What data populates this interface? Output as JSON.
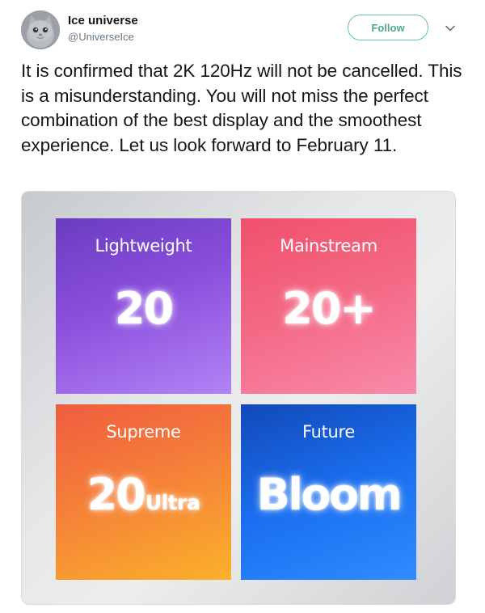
{
  "author": {
    "name": "Ice universe",
    "handle": "@UniverseIce",
    "avatar_icon": "cat-avatar-icon"
  },
  "actions": {
    "follow_label": "Follow",
    "more_icon": "chevron-down-icon"
  },
  "tweet": {
    "text": "It is confirmed that 2K 120Hz will not be cancelled. This is a misunderstanding. You will not miss the perfect combination of the best display and the smoothest experience. Let us look forward to February 11."
  },
  "media": {
    "tiles": [
      {
        "label": "Lightweight",
        "value": "20",
        "suffix": ""
      },
      {
        "label": "Mainstream",
        "value": "20+",
        "suffix": ""
      },
      {
        "label": "Supreme",
        "value": "20",
        "suffix": "Ultra"
      },
      {
        "label": "Future",
        "value": "Bloom",
        "suffix": ""
      }
    ]
  },
  "colors": {
    "follow_accent": "#4aa98b",
    "handle_gray": "#657786",
    "tile_purple": "#8b4fdc",
    "tile_pink": "#f46a86",
    "tile_orange": "#f57f39",
    "tile_blue": "#1a6ff0"
  }
}
